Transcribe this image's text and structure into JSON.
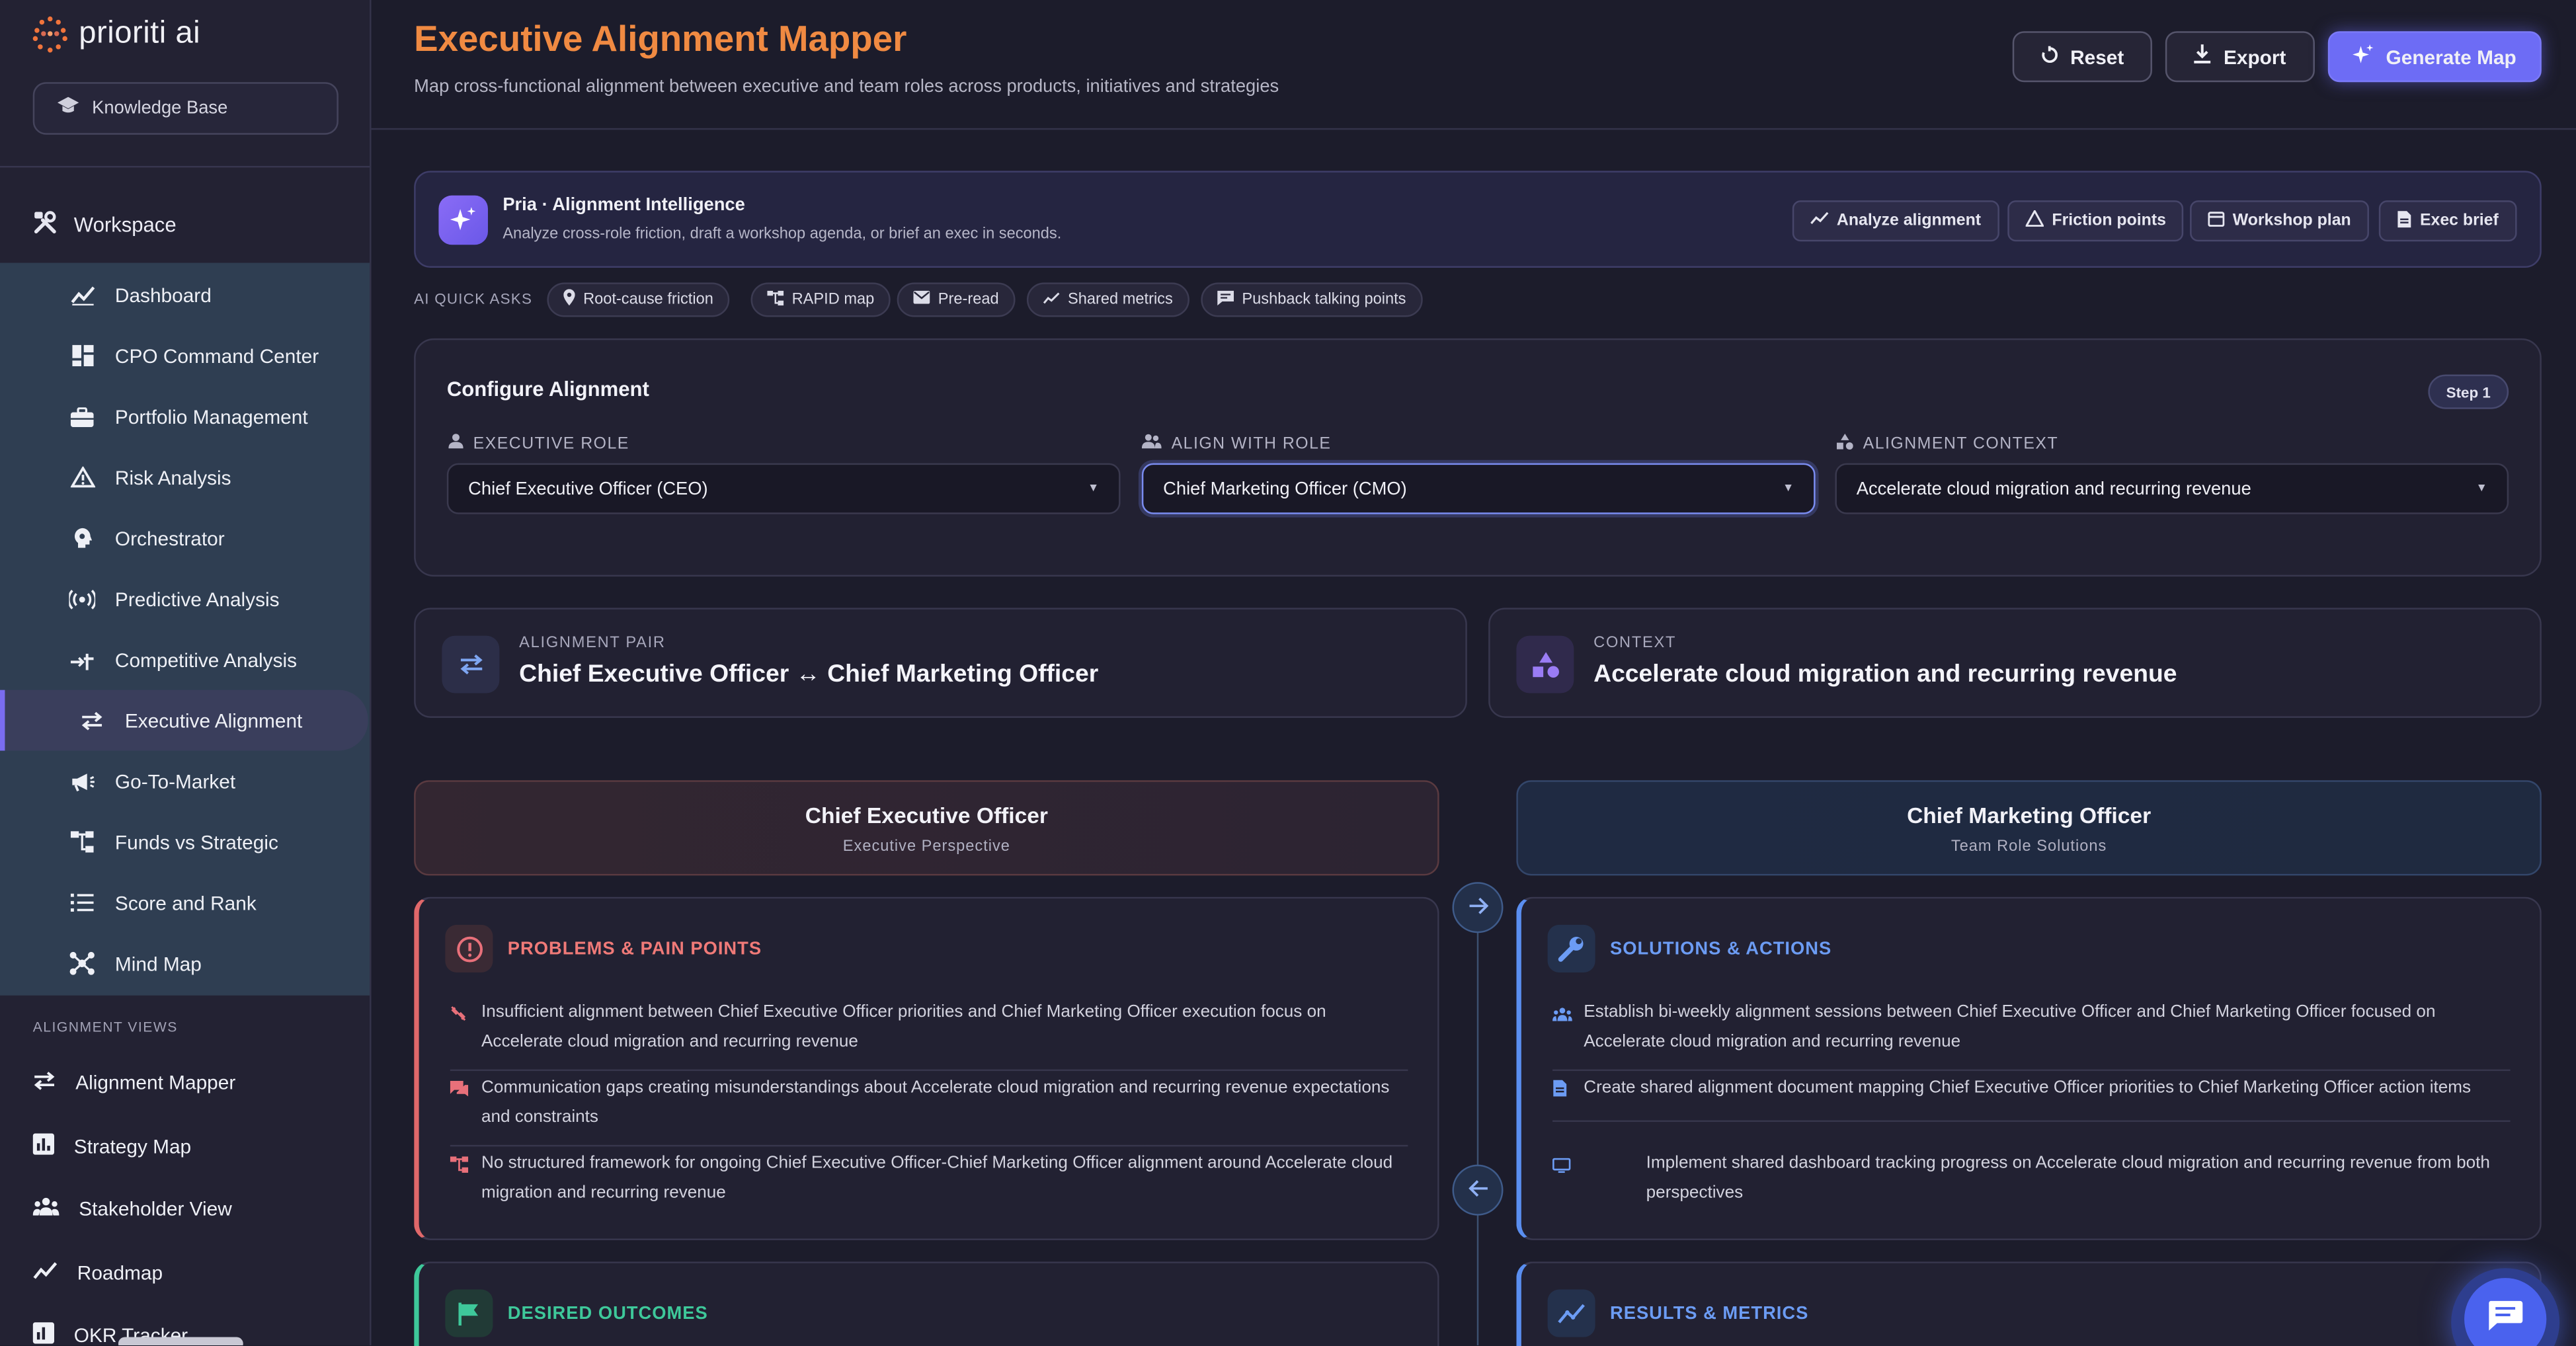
{
  "brand": {
    "name": "prioriti ai"
  },
  "sidebar": {
    "knowledge_base": "Knowledge Base",
    "workspace_label": "Workspace",
    "items": [
      {
        "label": "Dashboard",
        "icon": "trend-icon"
      },
      {
        "label": "CPO Command Center",
        "icon": "dashboard-icon"
      },
      {
        "label": "Portfolio Management",
        "icon": "briefcase-icon"
      },
      {
        "label": "Risk Analysis",
        "icon": "warning-icon"
      },
      {
        "label": "Orchestrator",
        "icon": "brain-icon"
      },
      {
        "label": "Predictive Analysis",
        "icon": "radar-icon"
      },
      {
        "label": "Competitive Analysis",
        "icon": "compare-icon"
      },
      {
        "label": "Executive Alignment",
        "icon": "swap-icon",
        "active": true
      },
      {
        "label": "Go-To-Market",
        "icon": "megaphone-icon"
      },
      {
        "label": "Funds vs Strategic",
        "icon": "hierarchy-icon"
      },
      {
        "label": "Score and Rank",
        "icon": "list-icon"
      },
      {
        "label": "Mind Map",
        "icon": "mindmap-icon"
      }
    ],
    "views_label": "ALIGNMENT VIEWS",
    "views": [
      {
        "label": "Alignment Mapper",
        "icon": "swap-icon"
      },
      {
        "label": "Strategy Map",
        "icon": "chart-icon"
      },
      {
        "label": "Stakeholder View",
        "icon": "people-icon"
      },
      {
        "label": "Roadmap",
        "icon": "trend-icon"
      },
      {
        "label": "OKR Tracker",
        "icon": "chart-icon"
      }
    ]
  },
  "header": {
    "title": "Executive Alignment Mapper",
    "subtitle": "Map cross-functional alignment between executive and team roles across products, initiatives and strategies",
    "reset": "Reset",
    "export": "Export",
    "generate": "Generate Map"
  },
  "pria": {
    "title": "Pria · Alignment Intelligence",
    "description": "Analyze cross-role friction, draft a workshop agenda, or brief an exec in seconds.",
    "actions": [
      "Analyze alignment",
      "Friction points",
      "Workshop plan",
      "Exec brief"
    ]
  },
  "quick_asks": {
    "label": "AI QUICK ASKS",
    "chips": [
      "Root-cause friction",
      "RAPID map",
      "Pre-read",
      "Shared metrics",
      "Pushback talking points"
    ]
  },
  "config": {
    "title": "Configure Alignment",
    "step": "Step 1",
    "executive_role_label": "EXECUTIVE ROLE",
    "executive_role_value": "Chief Executive Officer (CEO)",
    "align_role_label": "ALIGN WITH ROLE",
    "align_role_value": "Chief Marketing Officer (CMO)",
    "context_label": "ALIGNMENT CONTEXT",
    "context_value": "Accelerate cloud migration and recurring revenue"
  },
  "summary": {
    "pair_label": "ALIGNMENT PAIR",
    "pair_value": "Chief Executive Officer ↔ Chief Marketing Officer",
    "context_label": "CONTEXT",
    "context_value": "Accelerate cloud migration and recurring revenue"
  },
  "roles": {
    "exec_title": "Chief Executive Officer",
    "exec_sub": "Executive Perspective",
    "team_title": "Chief Marketing Officer",
    "team_sub": "Team Role Solutions"
  },
  "problems": {
    "title": "PROBLEMS & PAIN POINTS",
    "items": [
      "Insufficient alignment between Chief Executive Officer priorities and Chief Marketing Officer execution focus on Accelerate cloud migration and recurring revenue",
      "Communication gaps creating misunderstandings about Accelerate cloud migration and recurring revenue expectations and constraints",
      "No structured framework for ongoing Chief Executive Officer-Chief Marketing Officer alignment around Accelerate cloud migration and recurring revenue"
    ]
  },
  "solutions": {
    "title": "SOLUTIONS & ACTIONS",
    "items": [
      "Establish bi-weekly alignment sessions between Chief Executive Officer and Chief Marketing Officer focused on Accelerate cloud migration and recurring revenue",
      "Create shared alignment document mapping Chief Executive Officer priorities to Chief Marketing Officer action items",
      "Implement shared dashboard tracking progress on Accelerate cloud migration and recurring revenue from both perspectives"
    ]
  },
  "outcomes": {
    "title": "DESIRED OUTCOMES"
  },
  "results": {
    "title": "RESULTS & METRICS"
  },
  "colors": {
    "accent_orange": "#f08a42",
    "primary": "#6d6cf5",
    "problem": "#e0686a",
    "solution": "#5a8ef0",
    "outcome": "#3ec89a"
  }
}
